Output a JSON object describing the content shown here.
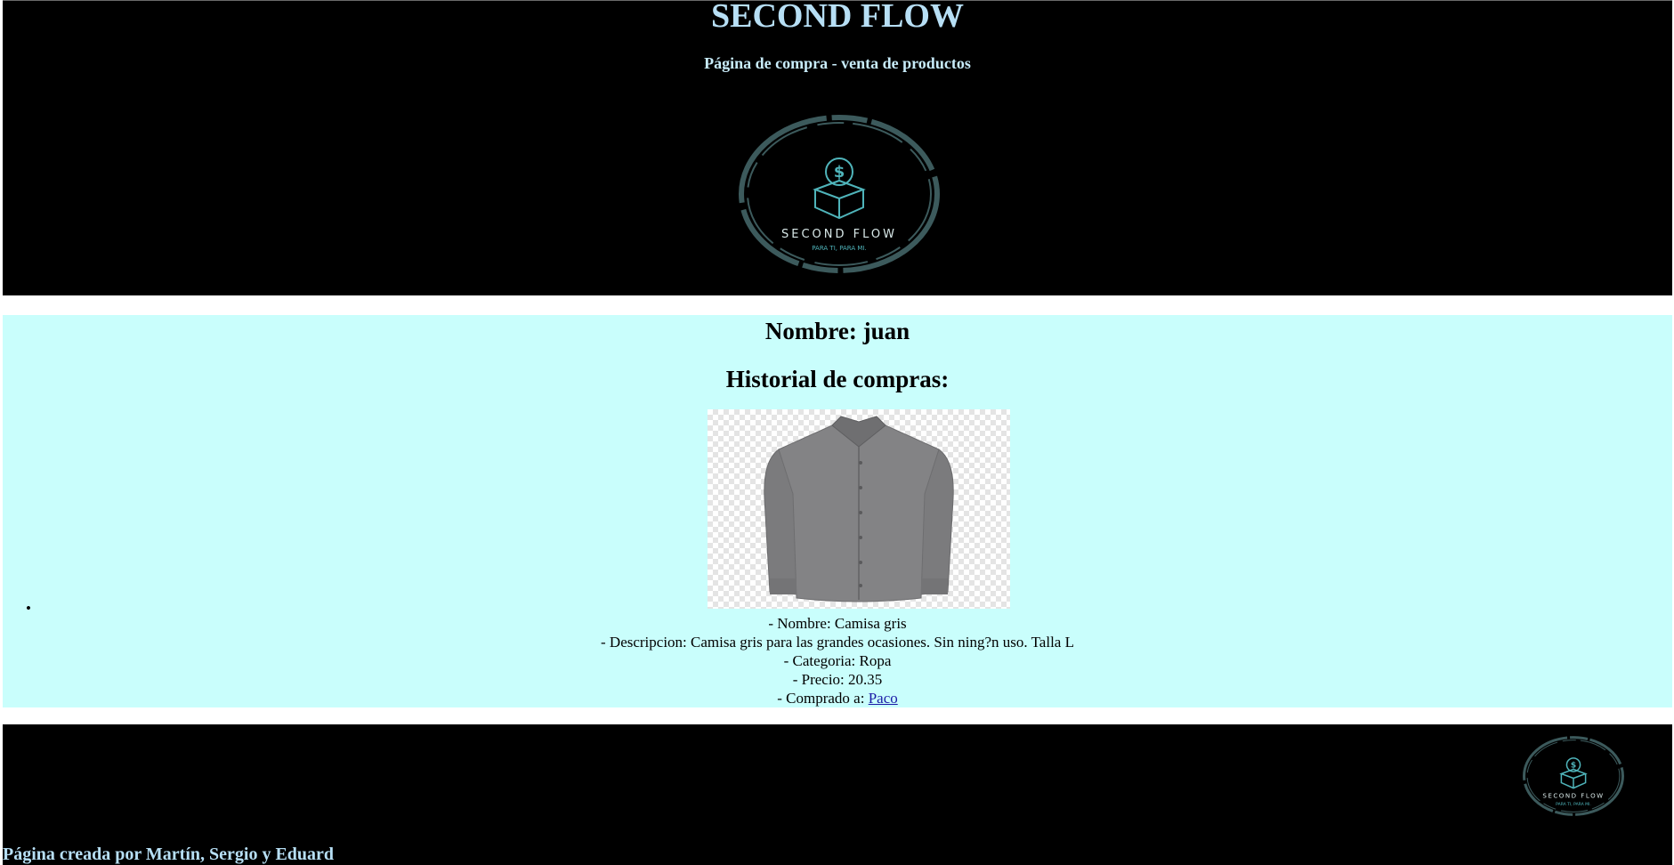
{
  "header": {
    "title": "SECOND FLOW",
    "subtitle": "Página de compra - venta de productos",
    "logo": {
      "name": "SECOND FLOW",
      "tagline": "PARA TI, PARA MI.",
      "icon": "dollar-box-icon"
    }
  },
  "main": {
    "user_label": "Nombre: juan",
    "history_title": "Historial de compras:",
    "purchases": [
      {
        "image": "grey-shirt-image",
        "name_line": "- Nombre: Camisa gris",
        "description_line": "- Descripcion: Camisa gris para las grandes ocasiones. Sin ning?n uso. Talla L",
        "category_line": "- Categoria: Ropa",
        "price_line": "- Precio: 20.35",
        "bought_from_label": "- Comprado a: ",
        "seller": "Paco"
      }
    ]
  },
  "footer": {
    "credits": "Página creada por Martín, Sergio y Eduard"
  },
  "colors": {
    "header_bg": "#000000",
    "title_color": "#b7dff5",
    "main_bg": "#c9fefc",
    "link_color": "#1a1aa6",
    "logo_ring": "#3c5a5c",
    "logo_teal": "#4fb4ba"
  }
}
